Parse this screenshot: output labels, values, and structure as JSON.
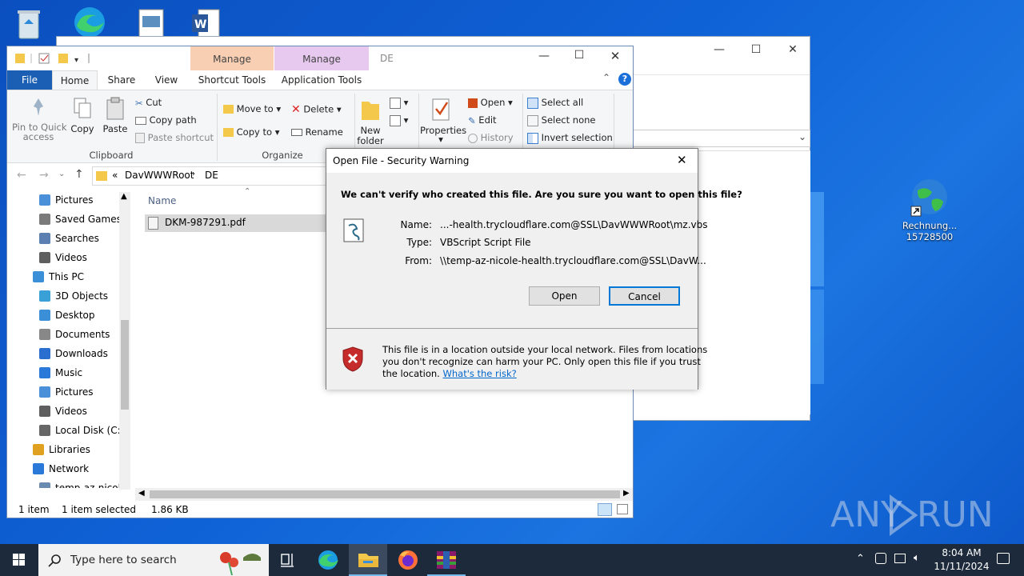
{
  "desktop": {
    "icons": [
      {
        "label": "Rechnung...\n15728500",
        "line1": "Rechnung...",
        "line2": "15728500"
      }
    ],
    "watermark": "ANY RUN"
  },
  "explorer": {
    "title": "DE",
    "contextual_tabs": [
      {
        "group": "Manage",
        "tab": "Shortcut Tools",
        "color": "#f8cfb3"
      },
      {
        "group": "Manage",
        "tab": "Application Tools",
        "color": "#e7c9f0"
      }
    ],
    "tabs": [
      "File",
      "Home",
      "Share",
      "View"
    ],
    "ribbon": {
      "clipboard": {
        "pin_label": "Pin to Quick",
        "pin_label2": "access",
        "copy": "Copy",
        "paste": "Paste",
        "cut": "Cut",
        "copy_path": "Copy path",
        "paste_shortcut": "Paste shortcut",
        "group": "Clipboard"
      },
      "organize": {
        "move_to": "Move to",
        "copy_to": "Copy to",
        "delete": "Delete",
        "rename": "Rename",
        "group": "Organize"
      },
      "new": {
        "new_folder": "New",
        "new_folder2": "folder"
      },
      "open": {
        "properties": "Properties",
        "open": "Open",
        "edit": "Edit",
        "history": "History"
      },
      "select": {
        "select_all": "Select all",
        "select_none": "Select none",
        "invert": "Invert selection"
      }
    },
    "address": {
      "prefix": "«",
      "crumb1": "DavWWWRoot",
      "crumb2": "DE"
    },
    "nav": [
      "Pictures",
      "Saved Games",
      "Searches",
      "Videos",
      "This PC",
      "3D Objects",
      "Desktop",
      "Documents",
      "Downloads",
      "Music",
      "Pictures",
      "Videos",
      "Local Disk (C:)",
      "Libraries",
      "Network",
      "temp-az-nicole"
    ],
    "column_name": "Name",
    "files": [
      {
        "name": "DKM-987291.pdf"
      }
    ],
    "status": {
      "count": "1 item",
      "selected": "1 item selected",
      "size": "1.86 KB"
    }
  },
  "dialog": {
    "title": "Open File - Security Warning",
    "question": "We can't verify who created this file. Are you sure you want to open this file?",
    "name_label": "Name:",
    "name_value": "...-health.trycloudflare.com@SSL\\DavWWWRoot\\mz.vbs",
    "type_label": "Type:",
    "type_value": "VBScript Script File",
    "from_label": "From:",
    "from_value": "\\\\temp-az-nicole-health.trycloudflare.com@SSL\\DavW...",
    "open_btn": "Open",
    "cancel_btn": "Cancel",
    "warning_line1": "This file is in a location outside your local network. Files from locations",
    "warning_line2": "you don't recognize can harm your PC. Only open this file if you trust",
    "warning_line3": "the location.",
    "risk_link": "What's the risk?"
  },
  "taskbar": {
    "search_placeholder": "Type here to search",
    "time": "8:04 AM",
    "date": "11/11/2024"
  }
}
